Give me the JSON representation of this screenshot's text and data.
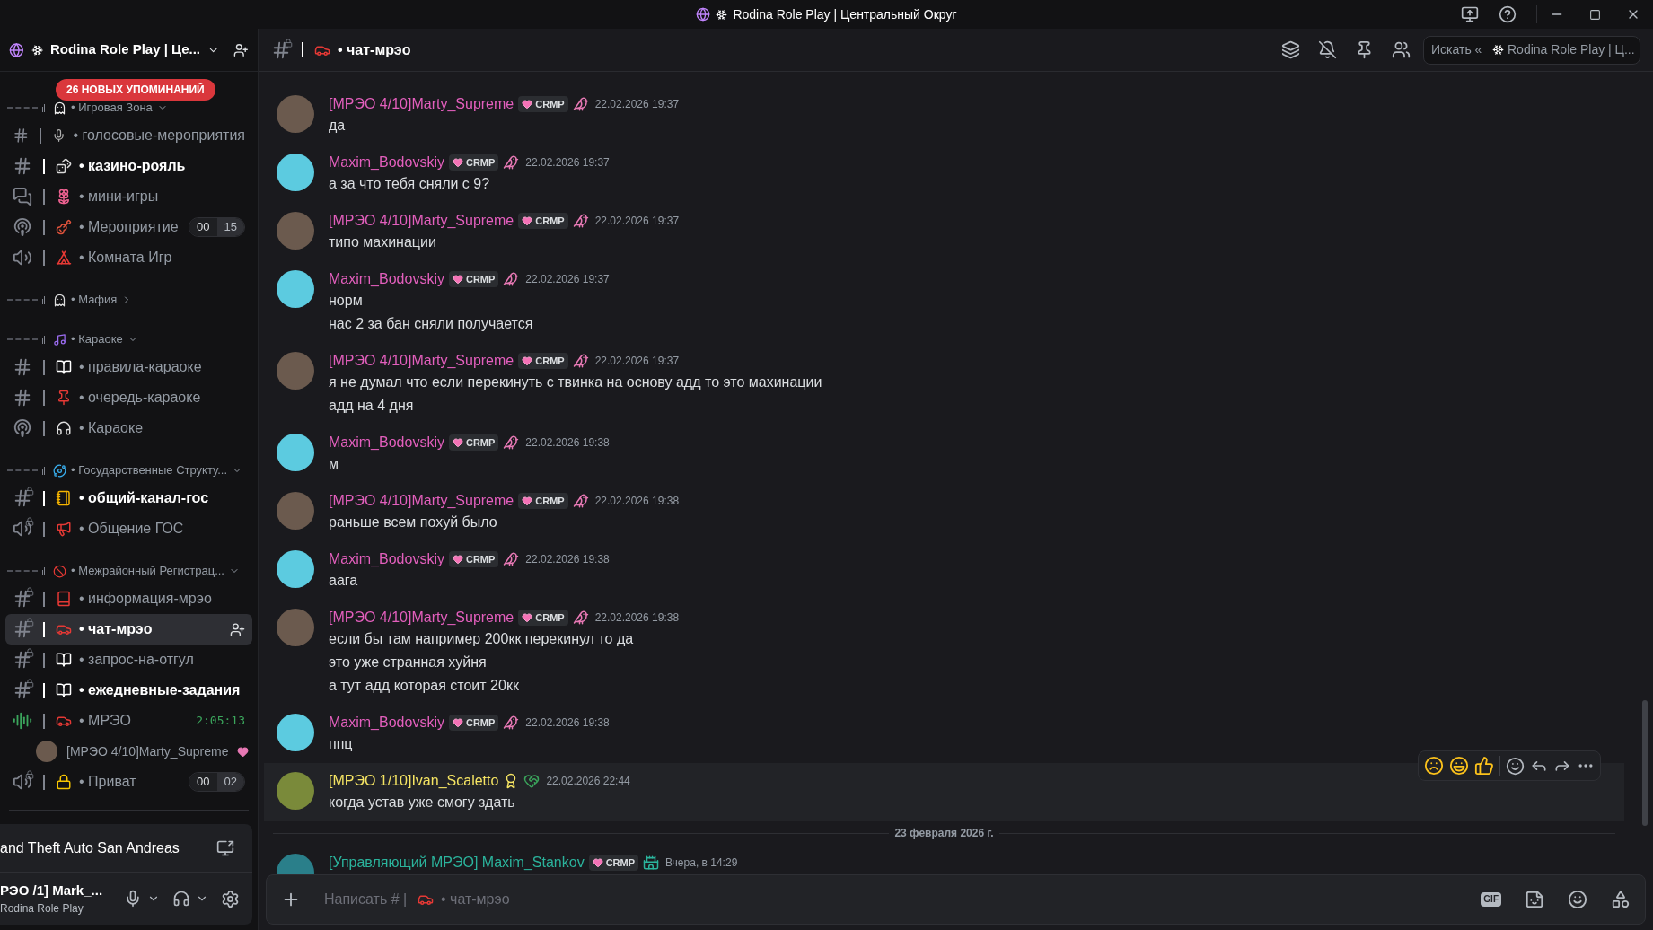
{
  "window": {
    "title": "Rodina Role Play | Центральный Округ"
  },
  "sidebar": {
    "server_name": "Rodina Role Play | Це...",
    "mentions_pill": "26 НОВЫХ УПОМИНАНИЙ",
    "sections": [
      {
        "category": "• Игровая Зона",
        "expanded": true,
        "channels": [
          {
            "name": "• голосовые-мероприятия",
            "kind": "text",
            "unread": false,
            "selected": false
          },
          {
            "name": "• казино-рояль",
            "kind": "text",
            "unread": true,
            "selected": false
          },
          {
            "name": "• мини-игры",
            "kind": "forum",
            "unread": false,
            "selected": false
          },
          {
            "name": "• Мероприятие",
            "kind": "stage",
            "unread": false,
            "selected": false,
            "limit": [
              "00",
              "15"
            ]
          },
          {
            "name": "• Комната Игр",
            "kind": "voice",
            "unread": false,
            "selected": false
          }
        ]
      },
      {
        "category": "• Мафия",
        "expanded": false
      },
      {
        "category": "• Караоке",
        "expanded": true,
        "channels": [
          {
            "name": "• правила-караоке",
            "kind": "text",
            "unread": false,
            "selected": false
          },
          {
            "name": "• очередь-караоке",
            "kind": "text",
            "unread": false,
            "selected": false
          },
          {
            "name": "• Караоке",
            "kind": "stage",
            "unread": false,
            "selected": false
          }
        ]
      },
      {
        "category": "• Государственные Структу...",
        "expanded": true,
        "channels": [
          {
            "name": "• общий-канал-гос",
            "kind": "locked_text",
            "unread": true,
            "selected": false
          },
          {
            "name": "• Общение ГОС",
            "kind": "locked_voice",
            "unread": false,
            "selected": false
          }
        ]
      },
      {
        "category": "• Межрайонный Регистрац...",
        "expanded": true,
        "channels": [
          {
            "name": "• информация-мрэо",
            "kind": "locked_text",
            "unread": false,
            "selected": false
          },
          {
            "name": "• чат-мрэо",
            "kind": "locked_text",
            "unread": true,
            "selected": true
          },
          {
            "name": "• запрос-на-отгул",
            "kind": "locked_text",
            "unread": false,
            "selected": false
          },
          {
            "name": "• ежедневные-задания",
            "kind": "locked_text",
            "unread": true,
            "selected": false
          },
          {
            "name": "• МРЭО",
            "kind": "active_voice",
            "unread": false,
            "selected": false,
            "timer": "2:05:13",
            "users": [
              {
                "name": "[МРЭО 4/10]Marty_Supreme"
              }
            ]
          },
          {
            "name": "• Приват",
            "kind": "locked_voice",
            "unread": false,
            "selected": false,
            "limit": [
              "00",
              "02"
            ]
          }
        ]
      }
    ]
  },
  "activity": {
    "title": "and Theft Auto San Andreas"
  },
  "user_panel": {
    "name": "РЭО /1] Mark_...",
    "server": "Rodina Role Play"
  },
  "channel_header": {
    "name": "• чат-мрэо",
    "search_placeholder": "Искать «",
    "search_scope": "Rodina Role Play | Ц..."
  },
  "chat": {
    "items": [
      {
        "kind": "message",
        "author": "[МРЭО 4/10]Marty_Supreme",
        "color": "#e35fbd",
        "badge": "CRMP",
        "time": "22.02.2026 19:37",
        "lines": [
          "да"
        ],
        "highlighted": false
      },
      {
        "kind": "message",
        "author": "Maxim_Bodovskiy",
        "color": "#e35fbd",
        "badge": "CRMP",
        "time": "22.02.2026 19:37",
        "lines": [
          "а за что тебя сняли с 9?"
        ],
        "highlighted": false
      },
      {
        "kind": "message",
        "author": "[МРЭО 4/10]Marty_Supreme",
        "color": "#e35fbd",
        "badge": "CRMP",
        "time": "22.02.2026 19:37",
        "lines": [
          "типо махинации"
        ],
        "highlighted": false
      },
      {
        "kind": "message",
        "author": "Maxim_Bodovskiy",
        "color": "#e35fbd",
        "badge": "CRMP",
        "time": "22.02.2026 19:37",
        "lines": [
          "норм",
          "нас 2 за бан сняли получается"
        ],
        "highlighted": false
      },
      {
        "kind": "message",
        "author": "[МРЭО 4/10]Marty_Supreme",
        "color": "#e35fbd",
        "badge": "CRMP",
        "time": "22.02.2026 19:37",
        "lines": [
          "я не думал что если перекинуть с твинка на основу адд то это махинации",
          "адд на 4 дня"
        ],
        "highlighted": false
      },
      {
        "kind": "message",
        "author": "Maxim_Bodovskiy",
        "color": "#e35fbd",
        "badge": "CRMP",
        "time": "22.02.2026 19:38",
        "lines": [
          "м"
        ],
        "highlighted": false
      },
      {
        "kind": "message",
        "author": "[МРЭО 4/10]Marty_Supreme",
        "color": "#e35fbd",
        "badge": "CRMP",
        "time": "22.02.2026 19:38",
        "lines": [
          "раньше всем похуй было"
        ],
        "highlighted": false
      },
      {
        "kind": "message",
        "author": "Maxim_Bodovskiy",
        "color": "#e35fbd",
        "badge": "CRMP",
        "time": "22.02.2026 19:38",
        "lines": [
          "аага"
        ],
        "highlighted": false
      },
      {
        "kind": "message",
        "author": "[МРЭО 4/10]Marty_Supreme",
        "color": "#e35fbd",
        "badge": "CRMP",
        "time": "22.02.2026 19:38",
        "lines": [
          "если бы там например 200кк перекинул то да",
          "это уже странная хуйня",
          "а тут адд которая стоит 20кк"
        ],
        "highlighted": false
      },
      {
        "kind": "message",
        "author": "Maxim_Bodovskiy",
        "color": "#e35fbd",
        "badge": "CRMP",
        "time": "22.02.2026 19:38",
        "lines": [
          "ппц"
        ],
        "highlighted": false
      },
      {
        "kind": "message",
        "author": "[МРЭО 1/10]Ivan_Scaletto",
        "color": "#f5e463",
        "time": "22.02.2026 22:44",
        "lines": [
          "когда устав уже смогу здать"
        ],
        "highlighted": true
      },
      {
        "kind": "date_divider",
        "label": "23 февраля 2026 г."
      },
      {
        "kind": "message",
        "author": "[Управляющий МРЭО] Maxim_Stankov",
        "color": "#2bb39c",
        "badge": "CRMP",
        "time": "Вчера, в 14:29",
        "highlighted": false
      }
    ]
  },
  "composer": {
    "placeholder": "Написать # |",
    "channel": "• чат-мрэо",
    "gif_label": "GIF"
  }
}
